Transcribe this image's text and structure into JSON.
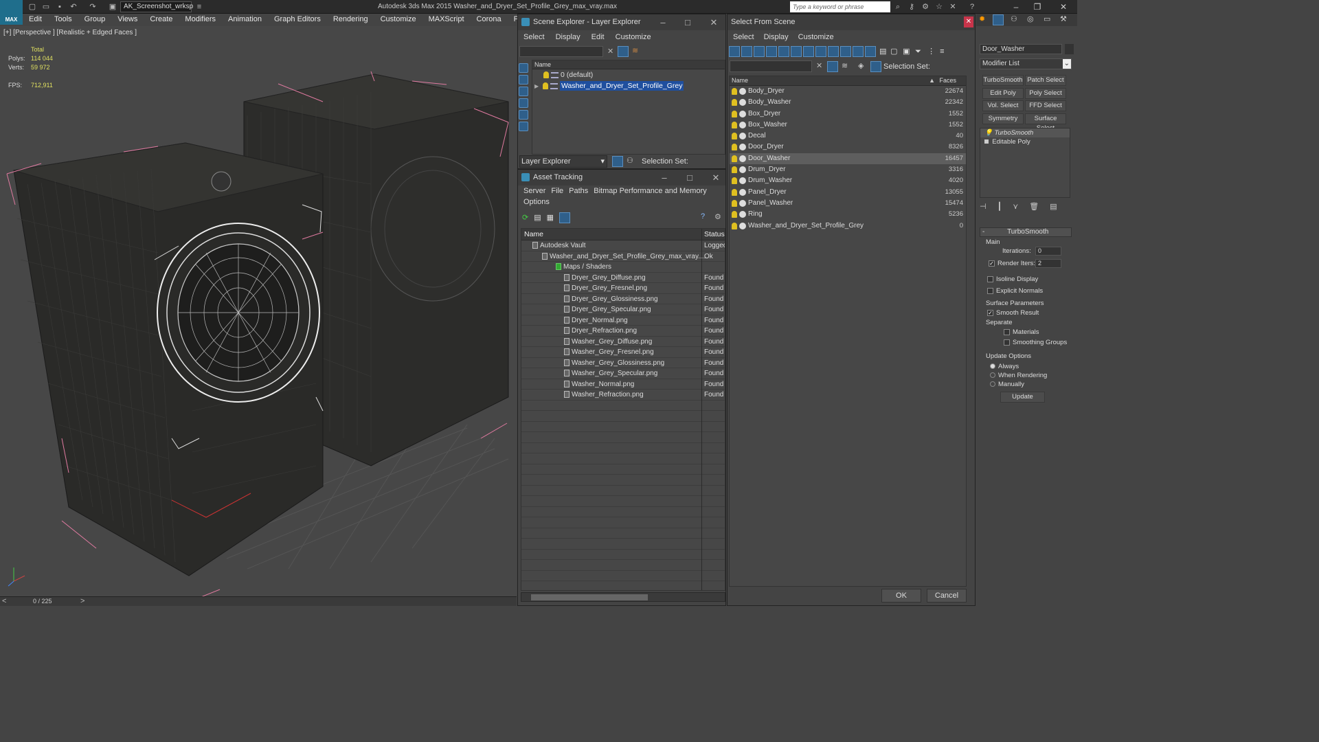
{
  "app": {
    "logo_text": "MAX",
    "title": "Autodesk 3ds Max  2015     Washer_and_Dryer_Set_Profile_Grey_max_vray.max",
    "workspace": "AK_Screenshot_wrksp",
    "search_placeholder": "Type a keyword or phrase"
  },
  "menu": [
    "Edit",
    "Tools",
    "Group",
    "Views",
    "Create",
    "Modifiers",
    "Animation",
    "Graph Editors",
    "Rendering",
    "Customize",
    "MAXScript",
    "Corona",
    "Project Man"
  ],
  "viewport": {
    "label": "[+] [Perspective ] [Realistic + Edged Faces ]",
    "stats": {
      "total_label": "Total",
      "polys_label": "Polys:",
      "polys": "114 044",
      "verts_label": "Verts:",
      "verts": "59 972",
      "fps_label": "FPS:",
      "fps": "712,911"
    }
  },
  "timeline": {
    "frame": "0 / 225"
  },
  "scene_explorer": {
    "title": "Scene Explorer - Layer Explorer",
    "menu": [
      "Select",
      "Display",
      "Edit",
      "Customize"
    ],
    "column": "Name",
    "layers": [
      {
        "name": "0 (default)",
        "selected": false
      },
      {
        "name": "Washer_and_Dryer_Set_Profile_Grey",
        "selected": true
      }
    ],
    "footer_label": "Layer Explorer",
    "selection_set_label": "Selection Set:"
  },
  "asset_tracking": {
    "title": "Asset Tracking",
    "menu": [
      "Server",
      "File",
      "Paths",
      "Bitmap Performance and Memory"
    ],
    "menu2": "Options",
    "col_name": "Name",
    "col_status": "Status",
    "rows": [
      {
        "name": "Autodesk Vault",
        "status": "Logged",
        "indent": 1
      },
      {
        "name": "Washer_and_Dryer_Set_Profile_Grey_max_vray....",
        "status": "Ok",
        "indent": 2
      },
      {
        "name": "Maps / Shaders",
        "status": "",
        "indent": 3
      },
      {
        "name": "Dryer_Grey_Diffuse.png",
        "status": "Found",
        "indent": 4
      },
      {
        "name": "Dryer_Grey_Fresnel.png",
        "status": "Found",
        "indent": 4
      },
      {
        "name": "Dryer_Grey_Glossiness.png",
        "status": "Found",
        "indent": 4
      },
      {
        "name": "Dryer_Grey_Specular.png",
        "status": "Found",
        "indent": 4
      },
      {
        "name": "Dryer_Normal.png",
        "status": "Found",
        "indent": 4
      },
      {
        "name": "Dryer_Refraction.png",
        "status": "Found",
        "indent": 4
      },
      {
        "name": "Washer_Grey_Diffuse.png",
        "status": "Found",
        "indent": 4
      },
      {
        "name": "Washer_Grey_Fresnel.png",
        "status": "Found",
        "indent": 4
      },
      {
        "name": "Washer_Grey_Glossiness.png",
        "status": "Found",
        "indent": 4
      },
      {
        "name": "Washer_Grey_Specular.png",
        "status": "Found",
        "indent": 4
      },
      {
        "name": "Washer_Normal.png",
        "status": "Found",
        "indent": 4
      },
      {
        "name": "Washer_Refraction.png",
        "status": "Found",
        "indent": 4
      }
    ]
  },
  "select_from_scene": {
    "title": "Select From Scene",
    "menu": [
      "Select",
      "Display",
      "Customize"
    ],
    "selection_set_label": "Selection Set:",
    "col_name": "Name",
    "col_faces": "Faces",
    "objects": [
      {
        "name": "Body_Dryer",
        "faces": "22674",
        "selected": false
      },
      {
        "name": "Body_Washer",
        "faces": "22342",
        "selected": false
      },
      {
        "name": "Box_Dryer",
        "faces": "1552",
        "selected": false
      },
      {
        "name": "Box_Washer",
        "faces": "1552",
        "selected": false
      },
      {
        "name": "Decal",
        "faces": "40",
        "selected": false
      },
      {
        "name": "Door_Dryer",
        "faces": "8326",
        "selected": false
      },
      {
        "name": "Door_Washer",
        "faces": "16457",
        "selected": true
      },
      {
        "name": "Drum_Dryer",
        "faces": "3316",
        "selected": false
      },
      {
        "name": "Drum_Washer",
        "faces": "4020",
        "selected": false
      },
      {
        "name": "Panel_Dryer",
        "faces": "13055",
        "selected": false
      },
      {
        "name": "Panel_Washer",
        "faces": "15474",
        "selected": false
      },
      {
        "name": "Ring",
        "faces": "5236",
        "selected": false
      },
      {
        "name": "Washer_and_Dryer_Set_Profile_Grey",
        "faces": "0",
        "selected": false
      }
    ],
    "ok": "OK",
    "cancel": "Cancel"
  },
  "command_panel": {
    "object_name": "Door_Washer",
    "modifier_list": "Modifier List",
    "buttons": [
      "TurboSmooth",
      "Patch Select",
      "Edit Poly",
      "Poly Select",
      "Vol. Select",
      "FFD Select",
      "Symmetry",
      "Surface Select"
    ],
    "stack": [
      "TurboSmooth",
      "Editable Poly"
    ],
    "rollout_title": "TurboSmooth",
    "main_label": "Main",
    "iterations_label": "Iterations:",
    "iterations": "0",
    "render_iters_label": "Render Iters:",
    "render_iters": "2",
    "isoline": "Isoline Display",
    "explicit_normals": "Explicit Normals",
    "surface_params": "Surface Parameters",
    "smooth_result": "Smooth Result",
    "separate": "Separate",
    "materials": "Materials",
    "smoothing_groups": "Smoothing Groups",
    "update_options": "Update Options",
    "always": "Always",
    "when_rendering": "When Rendering",
    "manually": "Manually",
    "update": "Update"
  }
}
